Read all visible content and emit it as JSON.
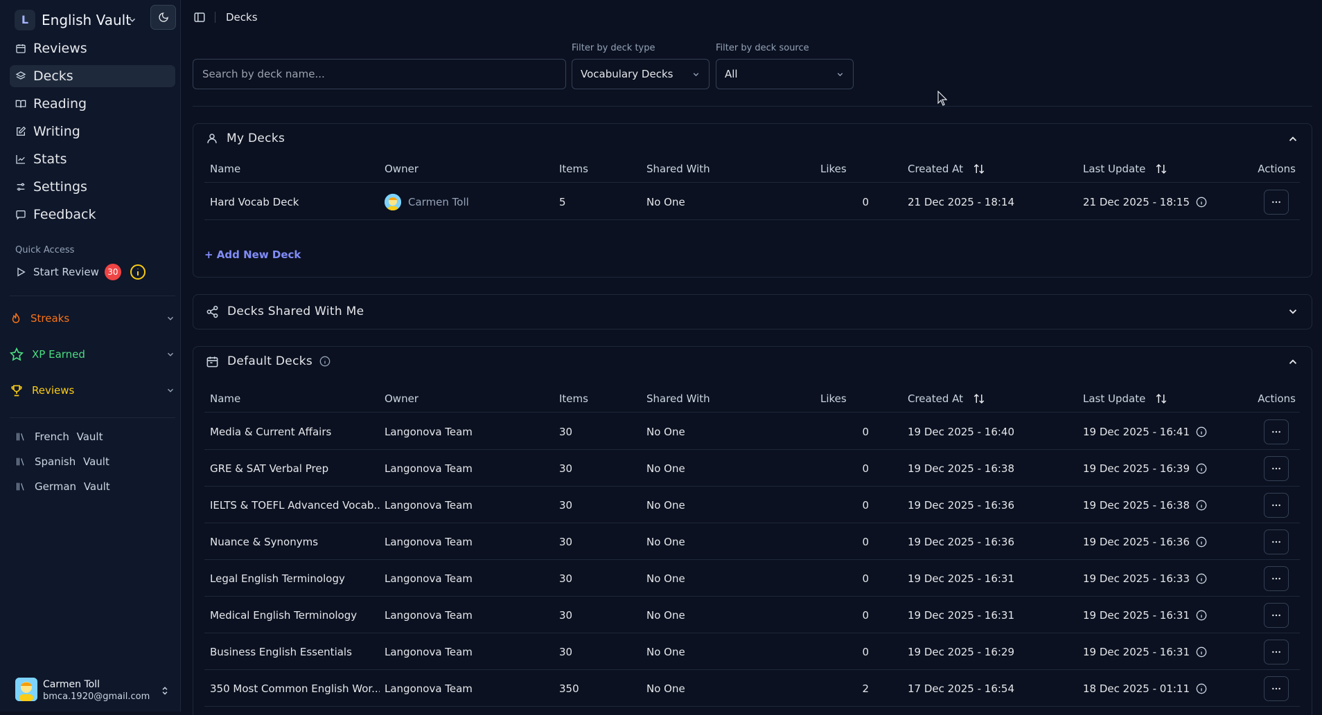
{
  "sidebar": {
    "vault_initial": "L",
    "vault_name": "English Vault",
    "nav": [
      {
        "label": "Reviews",
        "icon": "calendar-icon"
      },
      {
        "label": "Decks",
        "icon": "layers-icon",
        "active": true
      },
      {
        "label": "Reading",
        "icon": "book-open-icon"
      },
      {
        "label": "Writing",
        "icon": "pencil-square-icon"
      },
      {
        "label": "Stats",
        "icon": "chart-icon"
      },
      {
        "label": "Settings",
        "icon": "sliders-icon"
      },
      {
        "label": "Feedback",
        "icon": "message-icon"
      }
    ],
    "quick_access": {
      "title": "Quick Access",
      "start_review": "Start Review",
      "review_count": "30"
    },
    "accordions": [
      {
        "label": "Streaks",
        "color": "#f97316"
      },
      {
        "label": "XP Earned",
        "color": "#4ade80"
      },
      {
        "label": "Reviews",
        "color": "#facc15"
      }
    ],
    "vaults": [
      "French Vault",
      "Spanish Vault",
      "German Vault"
    ],
    "user": {
      "name": "Carmen Toll",
      "email": "bmca.1920@gmail.com"
    }
  },
  "topbar": {
    "breadcrumb": "Decks"
  },
  "filters": {
    "search_placeholder": "Search by deck name...",
    "deck_type_label": "Filter by deck type",
    "deck_type_value": "Vocabulary Decks",
    "deck_source_label": "Filter by deck source",
    "deck_source_value": "All"
  },
  "columns": {
    "name": "Name",
    "owner": "Owner",
    "items": "Items",
    "shared": "Shared With",
    "likes": "Likes",
    "created": "Created At",
    "updated": "Last Update",
    "actions": "Actions"
  },
  "my_decks": {
    "title": "My Decks",
    "rows": [
      {
        "name": "Hard Vocab Deck",
        "owner": "Carmen Toll",
        "items": "5",
        "shared": "No One",
        "likes": "0",
        "created": "21 Dec 2025 - 18:14",
        "updated": "21 Dec 2025 - 18:15"
      }
    ],
    "add_label": "+ Add New Deck"
  },
  "shared_decks": {
    "title": "Decks Shared With Me"
  },
  "default_decks": {
    "title": "Default Decks",
    "rows": [
      {
        "name": "Media & Current Affairs",
        "owner": "Langonova Team",
        "items": "30",
        "shared": "No One",
        "likes": "0",
        "created": "19 Dec 2025 - 16:40",
        "updated": "19 Dec 2025 - 16:41"
      },
      {
        "name": "GRE & SAT Verbal Prep",
        "owner": "Langonova Team",
        "items": "30",
        "shared": "No One",
        "likes": "0",
        "created": "19 Dec 2025 - 16:38",
        "updated": "19 Dec 2025 - 16:39"
      },
      {
        "name": "IELTS & TOEFL Advanced Vocab...",
        "owner": "Langonova Team",
        "items": "30",
        "shared": "No One",
        "likes": "0",
        "created": "19 Dec 2025 - 16:36",
        "updated": "19 Dec 2025 - 16:38"
      },
      {
        "name": "Nuance & Synonyms",
        "owner": "Langonova Team",
        "items": "30",
        "shared": "No One",
        "likes": "0",
        "created": "19 Dec 2025 - 16:36",
        "updated": "19 Dec 2025 - 16:36"
      },
      {
        "name": "Legal English Terminology",
        "owner": "Langonova Team",
        "items": "30",
        "shared": "No One",
        "likes": "0",
        "created": "19 Dec 2025 - 16:31",
        "updated": "19 Dec 2025 - 16:33"
      },
      {
        "name": "Medical English Terminology",
        "owner": "Langonova Team",
        "items": "30",
        "shared": "No One",
        "likes": "0",
        "created": "19 Dec 2025 - 16:31",
        "updated": "19 Dec 2025 - 16:31"
      },
      {
        "name": "Business English Essentials",
        "owner": "Langonova Team",
        "items": "30",
        "shared": "No One",
        "likes": "0",
        "created": "19 Dec 2025 - 16:29",
        "updated": "19 Dec 2025 - 16:31"
      },
      {
        "name": "350 Most Common English Wor...",
        "owner": "Langonova Team",
        "items": "350",
        "shared": "No One",
        "likes": "2",
        "created": "17 Dec 2025 - 16:54",
        "updated": "18 Dec 2025 - 01:11"
      }
    ]
  }
}
